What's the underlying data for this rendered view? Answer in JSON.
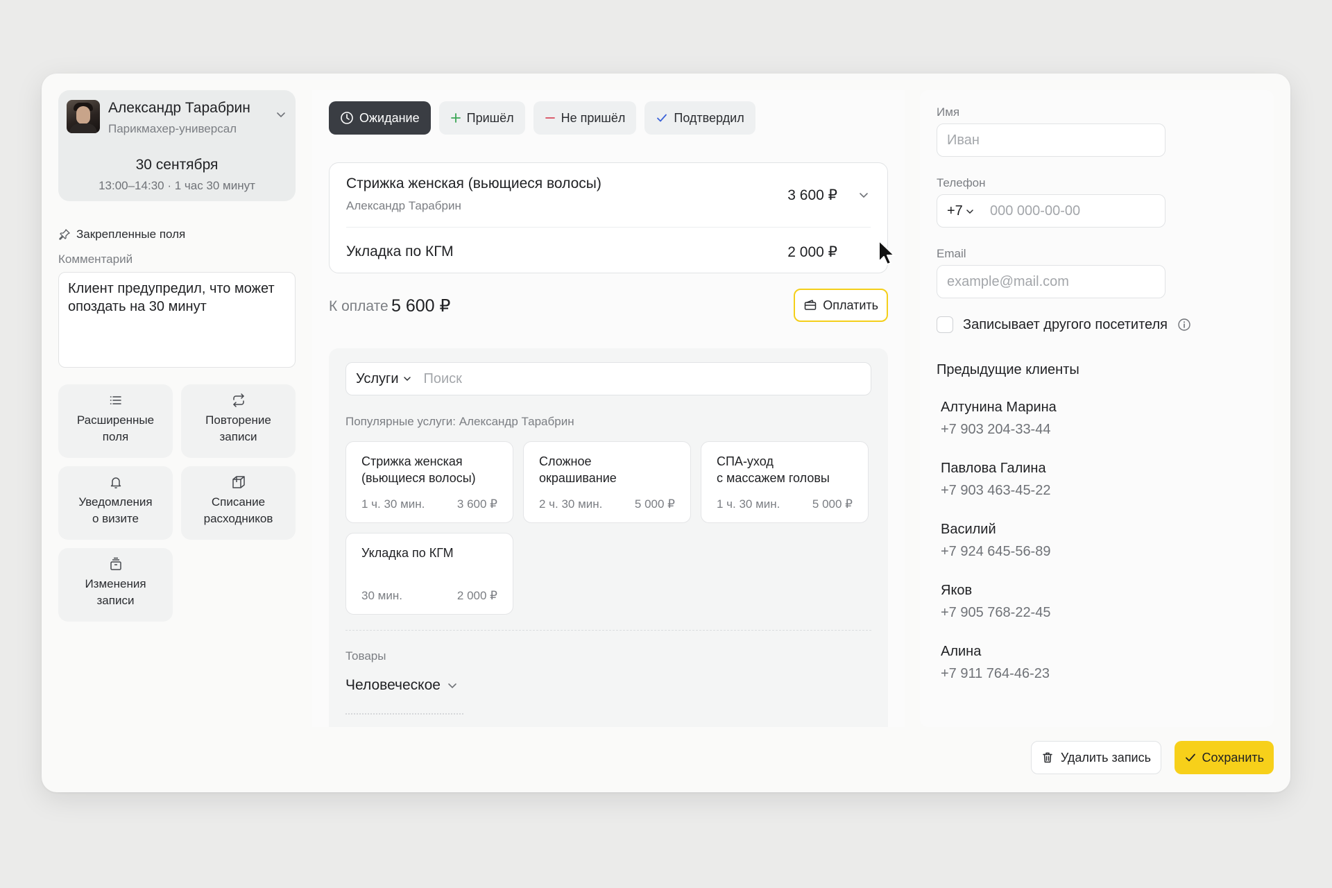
{
  "master": {
    "name": "Александр Тарабрин",
    "role": "Парикмахер-универсал",
    "date": "30 сентября",
    "time": "13:00–14:30 · 1 час 30 минут"
  },
  "pinned_label": "Закрепленные поля",
  "comment": {
    "label": "Комментарий",
    "value": "Клиент предупредил, что может опоздать на 30 минут"
  },
  "tiles": [
    {
      "label_1": "Расширенные",
      "label_2": "поля",
      "icon": "list-icon"
    },
    {
      "label_1": "Повторение",
      "label_2": "записи",
      "icon": "repeat-icon"
    },
    {
      "label_1": "Уведомления",
      "label_2": "о визите",
      "icon": "bell-icon"
    },
    {
      "label_1": "Списание",
      "label_2": "расходников",
      "icon": "box-icon"
    },
    {
      "label_1": "Изменения",
      "label_2": "записи",
      "icon": "archive-icon"
    }
  ],
  "status": {
    "waiting": "Ожидание",
    "arrived": "Пришёл",
    "not_arrived": "Не пришёл",
    "confirmed": "Подтвердил"
  },
  "services": [
    {
      "name": "Стрижка женская (вьющиеся волосы)",
      "master": "Александр Тарабрин",
      "price": "3 600 ₽"
    },
    {
      "name": "Укладка по КГМ",
      "price": "2 000 ₽"
    }
  ],
  "payment": {
    "label": "К оплате",
    "amount": "5 600 ₽",
    "button": "Оплатить"
  },
  "catalog": {
    "category": "Услуги",
    "search_placeholder": "Поиск",
    "popular_label": "Популярные услуги: Александр Тарабрин",
    "cards": [
      {
        "title_1": "Стрижка женская",
        "title_2": "(вьющиеся волосы)",
        "duration": "1 ч. 30 мин.",
        "price": "3 600 ₽"
      },
      {
        "title_1": "Сложное",
        "title_2": "окрашивание",
        "duration": "2 ч. 30 мин.",
        "price": "5 000 ₽"
      },
      {
        "title_1": "СПА-уход",
        "title_2": "с массажем головы",
        "duration": "1 ч. 30 мин.",
        "price": "5 000 ₽"
      },
      {
        "title_1": "Укладка по КГМ",
        "title_2": "",
        "duration": "30 мин.",
        "price": "2 000 ₽"
      }
    ],
    "goods_label": "Товары",
    "goods_category": "Человеческое"
  },
  "client_form": {
    "name_label": "Имя",
    "name_placeholder": "Иван",
    "phone_label": "Телефон",
    "phone_code": "+7",
    "phone_placeholder": "000 000-00-00",
    "email_label": "Email",
    "email_placeholder": "example@mail.com",
    "other_visitor": "Записывает другого посетителя"
  },
  "previous_clients": {
    "title": "Предыдущие клиенты",
    "items": [
      {
        "name": "Алтунина Марина",
        "phone": "+7 903 204-33-44"
      },
      {
        "name": "Павлова Галина",
        "phone": "+7 903 463-45-22"
      },
      {
        "name": "Василий",
        "phone": "+7 924 645-56-89"
      },
      {
        "name": "Яков",
        "phone": "+7 905 768-22-45"
      },
      {
        "name": "Алина",
        "phone": "+7 911 764-46-23"
      }
    ]
  },
  "footer": {
    "delete": "Удалить запись",
    "save": "Сохранить"
  },
  "colors": {
    "accent_yellow": "#f7d01a",
    "active_status": "#3a3d43",
    "arrived_green": "#3aa655",
    "not_arrived_red": "#d84a5b",
    "confirmed_blue": "#3b62d8"
  }
}
